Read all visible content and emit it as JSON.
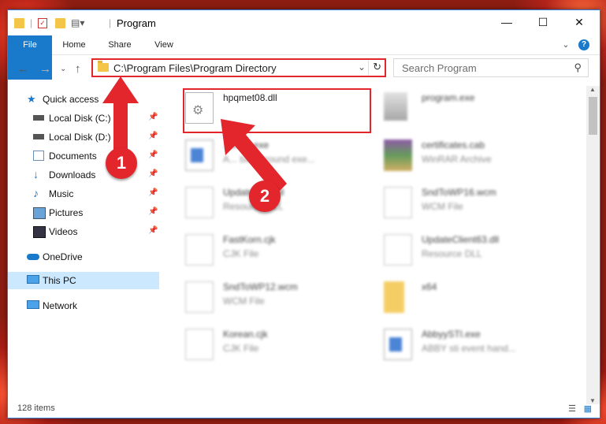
{
  "window": {
    "title": "Program"
  },
  "controls": {
    "minimize": "—",
    "maximize": "☐",
    "close": "✕"
  },
  "ribbon": {
    "tabs": [
      "File",
      "Home",
      "Share",
      "View"
    ]
  },
  "address": {
    "path": "C:\\Program Files\\Program Directory"
  },
  "search": {
    "placeholder": "Search Program"
  },
  "nav": {
    "items": [
      {
        "label": "Quick access",
        "icon": "star-icon"
      },
      {
        "label": "Local Disk (C:)",
        "icon": "drive-icon"
      },
      {
        "label": "Local Disk (D:)",
        "icon": "drive-icon"
      },
      {
        "label": "Documents",
        "icon": "documents-icon"
      },
      {
        "label": "Downloads",
        "icon": "downloads-icon"
      },
      {
        "label": "Music",
        "icon": "music-icon"
      },
      {
        "label": "Pictures",
        "icon": "pictures-icon"
      },
      {
        "label": "Videos",
        "icon": "videos-icon"
      },
      {
        "label": "OneDrive",
        "icon": "cloud-icon"
      },
      {
        "label": "This PC",
        "icon": "computer-icon"
      },
      {
        "label": "Network",
        "icon": "network-icon"
      }
    ]
  },
  "files": [
    {
      "name": "hpqmet08.dll",
      "type": ""
    },
    {
      "name": "program.exe",
      "type": ""
    },
    {
      "name": "...exec.exe",
      "type": "A... background exe..."
    },
    {
      "name": "certificates.cab",
      "type": "WinRAR Archive"
    },
    {
      "name": "Update...21.dll",
      "type": "Resource DLL"
    },
    {
      "name": "SndToWP16.wcm",
      "type": "WCM File"
    },
    {
      "name": "FastKorn.cjk",
      "type": "CJK File"
    },
    {
      "name": "UpdateClient63.dll",
      "type": "Resource DLL"
    },
    {
      "name": "SndToWP12.wcm",
      "type": "WCM File"
    },
    {
      "name": "x64",
      "type": ""
    },
    {
      "name": "Korean.cjk",
      "type": "CJK File"
    },
    {
      "name": "AbbyySTI.exe",
      "type": "ABBY sti event hand..."
    }
  ],
  "status": {
    "count": "128 items"
  },
  "annotations": {
    "step1": "1",
    "step2": "2"
  },
  "colors": {
    "accent": "#1979ca",
    "highlight": "#e2262c"
  }
}
